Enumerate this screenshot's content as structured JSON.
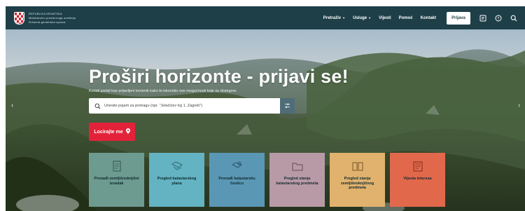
{
  "header": {
    "org_lines": [
      "REPUBLIKA HRVATSKA",
      "Ministarstvo prostornoga uređenja",
      "Državna geodetska uprava"
    ],
    "nav": [
      {
        "label": "Pretraživ",
        "dropdown": true
      },
      {
        "label": "Usluge",
        "dropdown": true
      },
      {
        "label": "Vijesti",
        "dropdown": false
      },
      {
        "label": "Pomoć",
        "dropdown": false
      },
      {
        "label": "Kontakt",
        "dropdown": false
      }
    ],
    "login_label": "Prijava",
    "icons": [
      "accessibility-icon",
      "language-icon",
      "search-icon"
    ]
  },
  "hero": {
    "title": "Proširi horizonte - prijavi se!",
    "subtitle": "Koristi portal kao prijavljeni korisnik kako bi iskoristio sve mogućnosti koje su dostupne.",
    "search_placeholder": "Unesite pojam za pretragu (npr. \"Jelačićev trg 1, Zagreb\")",
    "locate_label": "Locirajte me",
    "arrows": {
      "prev": "‹",
      "next": "›"
    }
  },
  "tiles": [
    {
      "label": "Pronađi zemljišnoknjižni izvadak",
      "color": "#6d9b8f",
      "icon": "document-icon"
    },
    {
      "label": "Pregled katastarskog plana",
      "color": "#63b3c2",
      "icon": "parcel-map-icon"
    },
    {
      "label": "Pronađi katastarsku česticu",
      "color": "#5a97b4",
      "icon": "parcel-search-icon"
    },
    {
      "label": "Pregled stanja katastarskog predmeta",
      "color": "#b89aa6",
      "icon": "folder-icon"
    },
    {
      "label": "Pregled stanja zemljišnoknjižnog predmeta",
      "color": "#e0b26e",
      "icon": "book-icon"
    },
    {
      "label": "Vijesta interesa",
      "color": "#e2684c",
      "icon": "news-icon"
    }
  ],
  "colors": {
    "header_bg": "#1e3f48",
    "accent_red": "#e3223a",
    "filter_bg": "#4f6d78"
  }
}
